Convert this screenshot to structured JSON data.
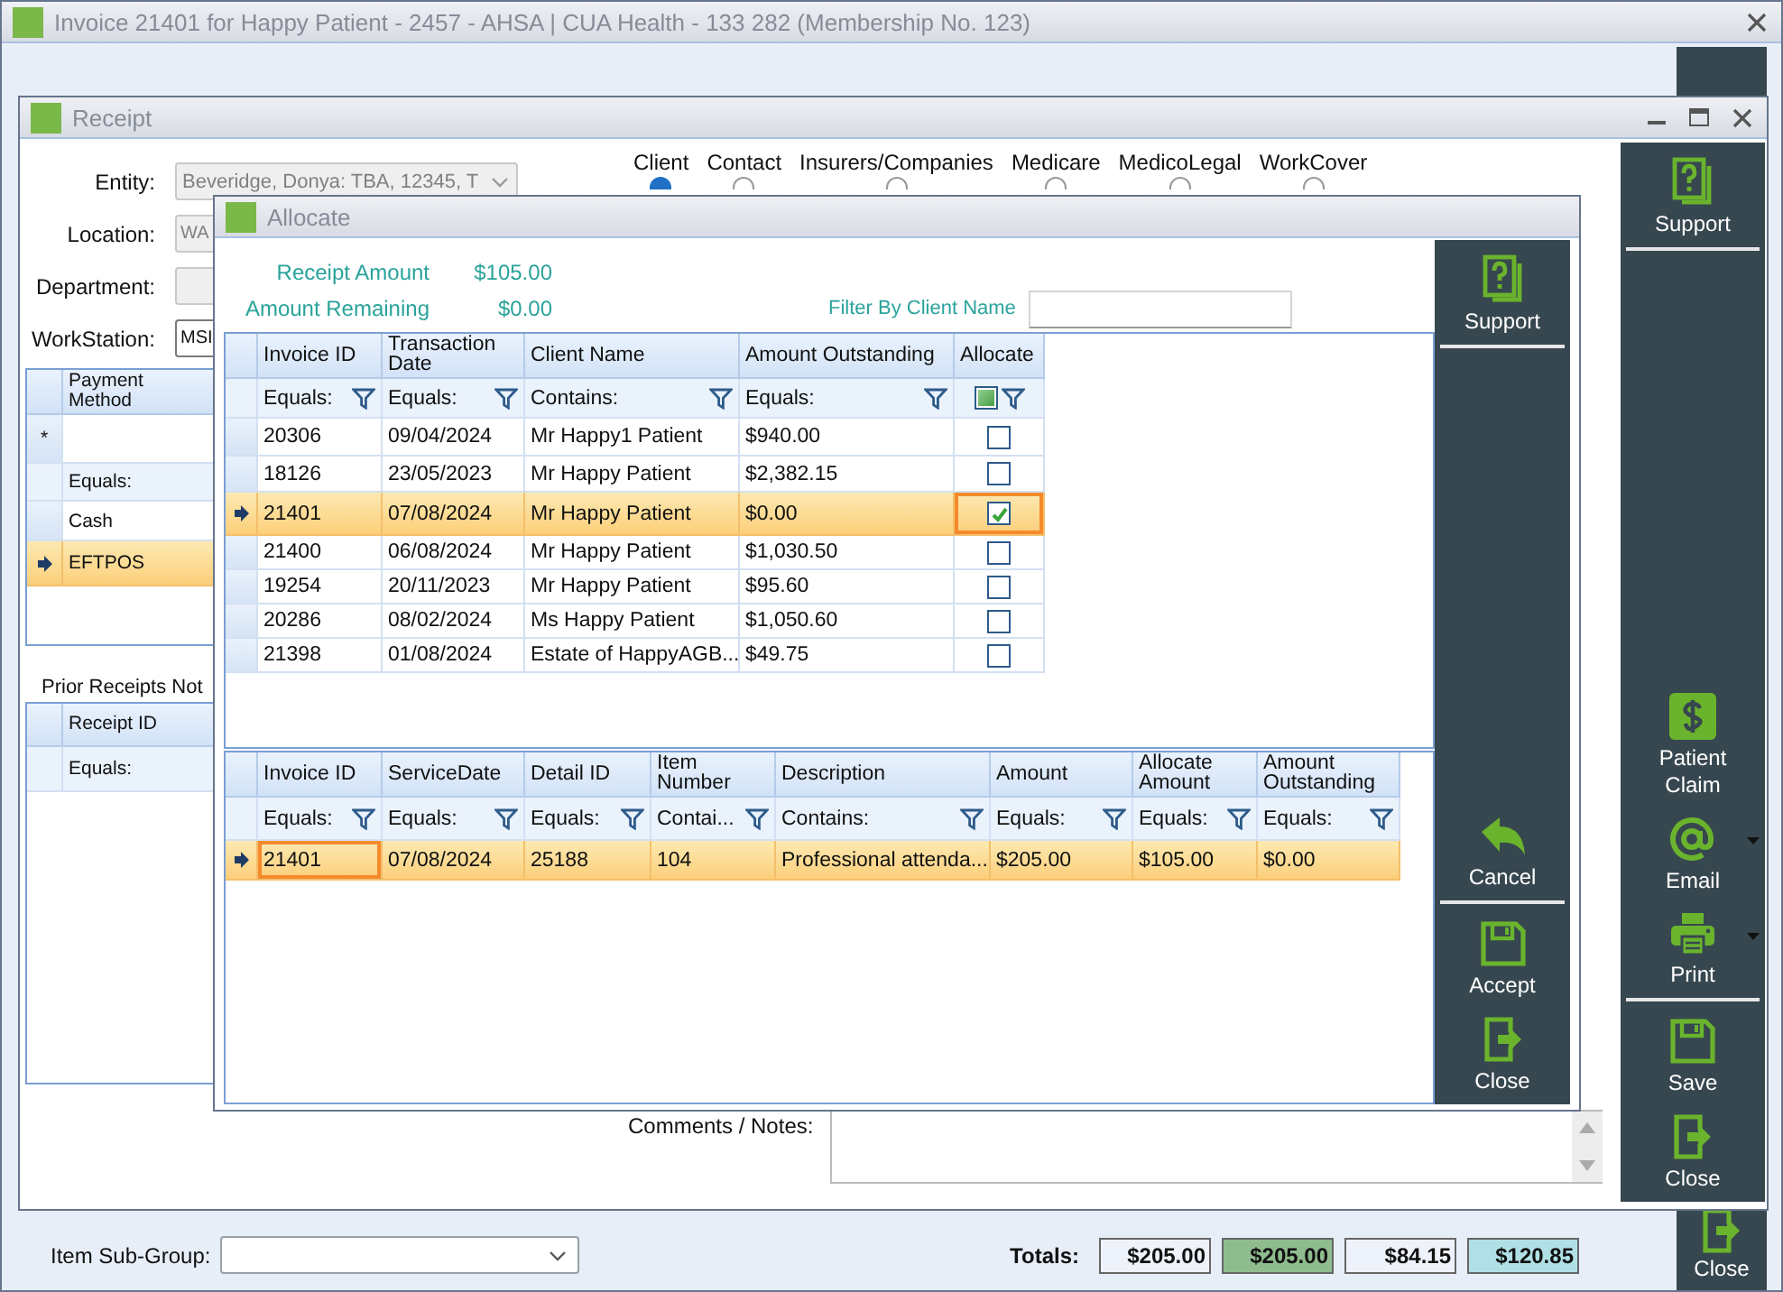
{
  "invoice_window": {
    "title": "Invoice 21401 for Happy Patient - 2457 - AHSA | CUA Health - 133 282 (Membership No. 123)",
    "item_sub_group": {
      "label": "Item Sub-Group:"
    },
    "totals": {
      "label": "Totals:",
      "values": [
        {
          "text": "$205.00",
          "color": "#eef2fa"
        },
        {
          "text": "$205.00",
          "color": "#8fbc8f"
        },
        {
          "text": "$84.15",
          "color": "#eef2fa"
        },
        {
          "text": "$120.85",
          "color": "#b0e0e6"
        }
      ]
    },
    "sidebar": {
      "bottom": [
        {
          "kind": "close",
          "label": "Close",
          "dropdown": false,
          "divider_after": false
        }
      ]
    }
  },
  "receipt_window": {
    "title": "Receipt",
    "fields": [
      {
        "label": "Entity:",
        "value": "Beveridge, Donya: TBA, 12345, T",
        "kind": "dropdown",
        "disabled": true
      },
      {
        "label": "Location:",
        "value": "WA",
        "kind": "text",
        "disabled": true
      },
      {
        "label": "Department:",
        "kind": "text",
        "disabled": true
      },
      {
        "label": "WorkStation:",
        "value": "MSI",
        "kind": "text",
        "disabled": false
      }
    ],
    "contact_types": [
      {
        "label": "Client",
        "selected": true
      },
      {
        "label": "Contact",
        "selected": false
      },
      {
        "label": "Insurers/Companies",
        "selected": false
      },
      {
        "label": "Medicare",
        "selected": false
      },
      {
        "label": "MedicoLegal",
        "selected": false
      },
      {
        "label": "WorkCover",
        "selected": false
      }
    ],
    "payments": {
      "columns": [
        {
          "label": "Payment Method",
          "filter": "Equals:",
          "kind": "text",
          "focused": false
        }
      ],
      "new_row_marker": "*",
      "rows": [
        {
          "cells": [
            "Cash"
          ],
          "selected": false
        },
        {
          "cells": [
            "EFTPOS"
          ],
          "selected": true
        }
      ]
    },
    "prior_receipts": {
      "label": "Prior Receipts Not",
      "columns": [
        {
          "label": "Receipt ID",
          "filter": "Equals:",
          "kind": "text"
        }
      ]
    },
    "comments_label": "Comments / Notes:",
    "sidebar": {
      "top": [
        {
          "kind": "support",
          "label": "Support",
          "dropdown": false,
          "divider_after": true
        }
      ],
      "bottom": [
        {
          "kind": "claim",
          "label": "Patient Claim",
          "dropdown": false,
          "divider_after": false
        },
        {
          "kind": "email",
          "label": "Email",
          "dropdown": true,
          "divider_after": false
        },
        {
          "kind": "print",
          "label": "Print",
          "dropdown": true,
          "divider_after": true
        },
        {
          "kind": "save",
          "label": "Save",
          "dropdown": false,
          "divider_after": false
        },
        {
          "kind": "close",
          "label": "Close",
          "dropdown": false,
          "divider_after": false
        }
      ]
    }
  },
  "allocate_window": {
    "title": "Allocate",
    "summary": [
      {
        "label": "Receipt Amount",
        "value": "$105.00"
      },
      {
        "label": "Amount Remaining",
        "value": "$0.00"
      }
    ],
    "client_filter": {
      "label": "Filter By Client Name"
    },
    "invoices": {
      "columns": [
        {
          "label": "Invoice ID",
          "filter": "Equals:",
          "kind": "text",
          "focused": false
        },
        {
          "label": "Transaction Date",
          "filter": "Equals:",
          "kind": "text",
          "focused": false
        },
        {
          "label": "Client Name",
          "filter": "Contains:",
          "kind": "text",
          "focused": false
        },
        {
          "label": "Amount Outstanding",
          "filter": "Equals:",
          "kind": "text",
          "focused": false
        },
        {
          "label": "Allocate",
          "kind": "checkbox",
          "indeterminate": true,
          "focused": true
        }
      ],
      "rows": [
        {
          "cells": [
            "20306",
            "09/04/2024",
            "Mr Happy1 Patient",
            "$940.00"
          ],
          "checked": false,
          "selected": false
        },
        {
          "cells": [
            "18126",
            "23/05/2023",
            "Mr Happy Patient",
            "$2,382.15"
          ],
          "checked": false,
          "selected": false
        },
        {
          "cells": [
            "21401",
            "07/08/2024",
            "Mr Happy Patient",
            "$0.00"
          ],
          "checked": true,
          "selected": true
        },
        {
          "cells": [
            "21400",
            "06/08/2024",
            "Mr Happy Patient",
            "$1,030.50"
          ],
          "checked": false,
          "selected": false
        },
        {
          "cells": [
            "19254",
            "20/11/2023",
            "Mr Happy Patient",
            "$95.60"
          ],
          "checked": false,
          "selected": false
        },
        {
          "cells": [
            "20286",
            "08/02/2024",
            "Ms Happy Patient",
            "$1,050.60"
          ],
          "checked": false,
          "selected": false
        },
        {
          "cells": [
            "21398",
            "01/08/2024",
            "Estate of HappyAGB...",
            "$49.75"
          ],
          "checked": false,
          "selected": false
        }
      ]
    },
    "details": {
      "columns": [
        {
          "label": "Invoice ID",
          "filter": "Equals:",
          "kind": "text",
          "focused": true
        },
        {
          "label": "ServiceDate",
          "filter": "Equals:",
          "kind": "text",
          "focused": false
        },
        {
          "label": "Detail ID",
          "filter": "Equals:",
          "kind": "text",
          "focused": false
        },
        {
          "label": "Item Number",
          "filter": "Contai...",
          "kind": "text",
          "focused": false
        },
        {
          "label": "Description",
          "filter": "Contains:",
          "kind": "text",
          "focused": false
        },
        {
          "label": "Amount",
          "filter": "Equals:",
          "kind": "text",
          "focused": false
        },
        {
          "label": "Allocate Amount",
          "filter": "Equals:",
          "kind": "text",
          "focused": false
        },
        {
          "label": "Amount Outstanding",
          "filter": "Equals:",
          "kind": "text",
          "focused": false
        }
      ],
      "rows": [
        {
          "cells": [
            "21401",
            "07/08/2024",
            "25188",
            "104",
            "Professional attenda...",
            "$205.00",
            "$105.00",
            "$0.00"
          ],
          "selected": true
        }
      ]
    },
    "sidebar": {
      "top": [
        {
          "kind": "support",
          "label": "Support",
          "dropdown": false,
          "divider_after": true
        }
      ],
      "bottom": [
        {
          "kind": "cancel",
          "label": "Cancel",
          "dropdown": false,
          "divider_after": true
        },
        {
          "kind": "accept",
          "label": "Accept",
          "dropdown": false,
          "divider_after": false
        },
        {
          "kind": "close",
          "label": "Close",
          "dropdown": false,
          "divider_after": false
        }
      ]
    }
  }
}
